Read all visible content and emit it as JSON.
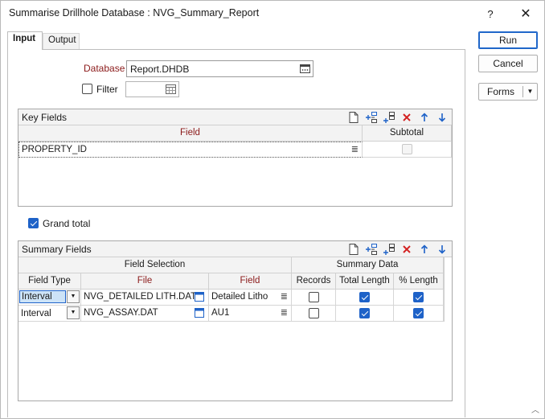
{
  "window": {
    "title": "Summarise Drillhole Database : NVG_Summary_Report",
    "help_label": "?",
    "close_label": "✕"
  },
  "tabs": [
    {
      "label": "Input",
      "active": true
    },
    {
      "label": "Output",
      "active": false
    }
  ],
  "buttons": {
    "run": "Run",
    "cancel": "Cancel",
    "forms": "Forms"
  },
  "database": {
    "label": "Database",
    "value": "Report.DHDB"
  },
  "filter": {
    "label": "Filter",
    "checked": false,
    "value": ""
  },
  "key_fields": {
    "title": "Key Fields",
    "columns": [
      "Field",
      "Subtotal"
    ],
    "rows": [
      {
        "field": "PROPERTY_ID",
        "subtotal": false
      }
    ]
  },
  "grand_total": {
    "label": "Grand total",
    "checked": true
  },
  "summary_fields": {
    "title": "Summary Fields",
    "group_headers": [
      "Field Selection",
      "Summary Data"
    ],
    "columns": [
      "Field Type",
      "File",
      "Field",
      "Records",
      "Total Length",
      "% Length"
    ],
    "rows": [
      {
        "field_type": "Interval",
        "file": "NVG_DETAILED LITH.DAT",
        "field": "Detailed Litho",
        "records": false,
        "total_length": true,
        "pct_length": true
      },
      {
        "field_type": "Interval",
        "file": "NVG_ASSAY.DAT",
        "field": "AU1",
        "records": false,
        "total_length": true,
        "pct_length": true
      }
    ]
  },
  "icons": [
    "new-icon",
    "insert-row-icon",
    "append-row-icon",
    "delete-icon",
    "move-up-icon",
    "move-down-icon",
    "browse-icon",
    "calendar-icon"
  ],
  "colors": {
    "accent": "#1e62c8",
    "required_label": "#8b1a1a",
    "delete_icon": "#d32020"
  }
}
